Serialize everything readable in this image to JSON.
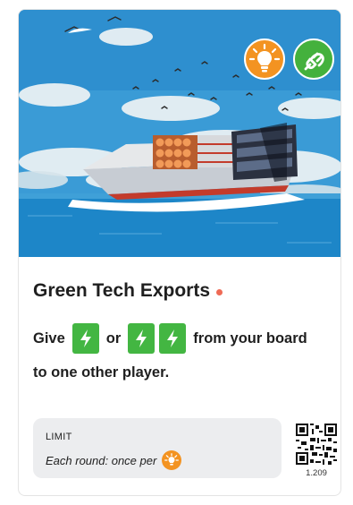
{
  "card": {
    "title": "Green Tech Exports",
    "effect": {
      "give_word": "Give",
      "or_word": "or",
      "from_text": "from your board",
      "line2": "to one other player."
    },
    "limit": {
      "label": "LIMIT",
      "text": "Each round: once per"
    },
    "version": "1.209",
    "badges": [
      "lightbulb-icon",
      "plug-icon"
    ],
    "colors": {
      "energy_green": "#43b642",
      "idea_orange": "#f39321",
      "title_dot": "#ef6a55",
      "limit_bg": "#ecedef"
    }
  }
}
